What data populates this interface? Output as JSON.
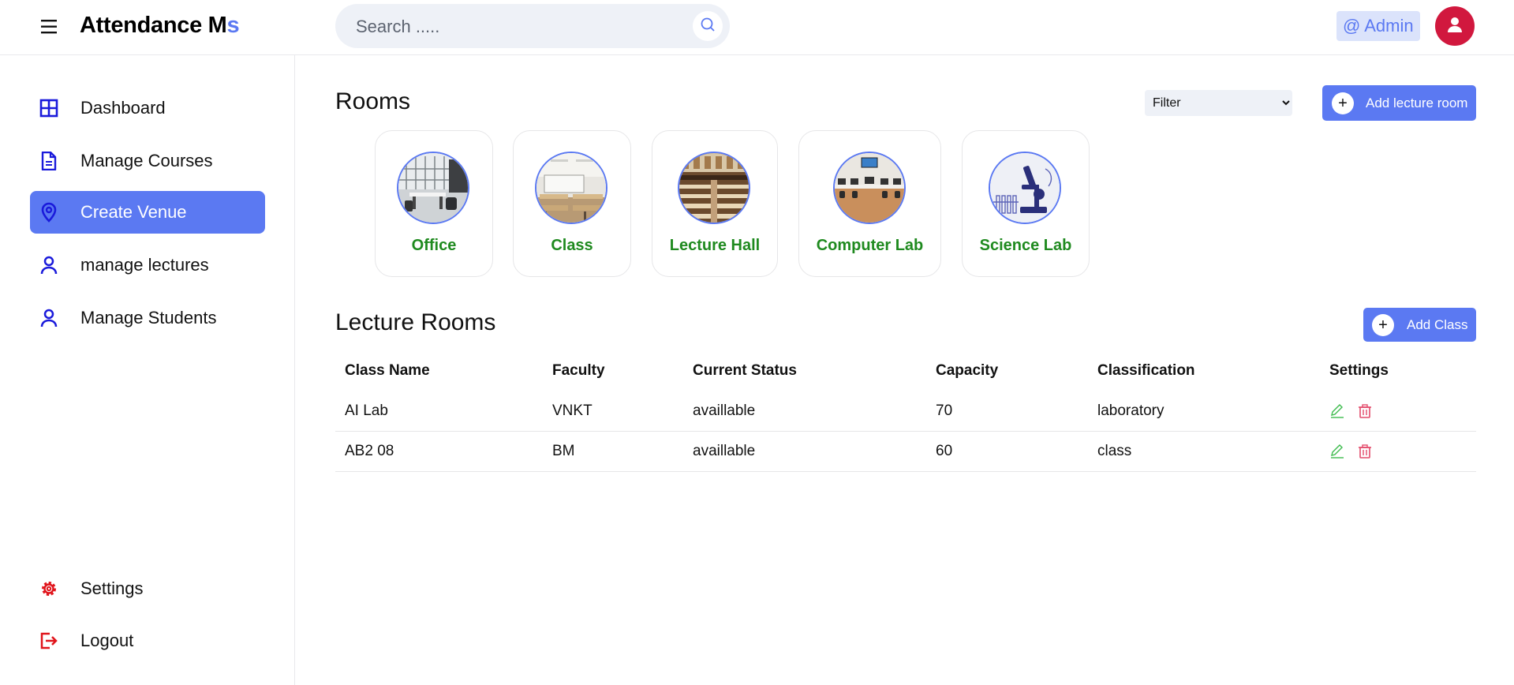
{
  "header": {
    "brand_main": "Attendance M",
    "brand_accent": "s",
    "search_placeholder": "Search .....",
    "user_badge": "@ Admin"
  },
  "sidebar": {
    "items": [
      {
        "label": "Dashboard",
        "icon": "grid-icon"
      },
      {
        "label": "Manage Courses",
        "icon": "document-icon"
      },
      {
        "label": "Create Venue",
        "icon": "location-pin-icon",
        "active": true
      },
      {
        "label": "manage lectures",
        "icon": "user-icon"
      },
      {
        "label": "Manage Students",
        "icon": "user-icon"
      }
    ],
    "bottom": [
      {
        "label": "Settings",
        "icon": "gear-icon"
      },
      {
        "label": "Logout",
        "icon": "logout-icon"
      }
    ]
  },
  "rooms": {
    "title": "Rooms",
    "filter": {
      "selected": "Filter",
      "options": [
        "Filter"
      ]
    },
    "add_label": "Add lecture room",
    "cards": [
      {
        "name": "Office",
        "image": "office-photo"
      },
      {
        "name": "Class",
        "image": "classroom-photo"
      },
      {
        "name": "Lecture Hall",
        "image": "lecture-hall-photo"
      },
      {
        "name": "Computer Lab",
        "image": "computer-lab-photo"
      },
      {
        "name": "Science Lab",
        "image": "microscope-photo"
      }
    ]
  },
  "lecture_rooms": {
    "title": "Lecture Rooms",
    "add_label": "Add Class",
    "columns": [
      "Class Name",
      "Faculty",
      "Current Status",
      "Capacity",
      "Classification",
      "Settings"
    ],
    "rows": [
      {
        "class_name": "AI Lab",
        "faculty": "VNKT",
        "status": "availlable",
        "capacity": "70",
        "classification": "laboratory"
      },
      {
        "class_name": "AB2 08",
        "faculty": "BM",
        "status": "availlable",
        "capacity": "60",
        "classification": "class"
      }
    ]
  },
  "colors": {
    "accent": "#5b79f2",
    "room_label": "#1f8a1f",
    "avatar": "#d1183e",
    "nav_icon": "#1a1adb",
    "bottom_icon": "#e0141b",
    "edit_icon": "#3dbb4d",
    "delete_icon": "#e34b6b"
  }
}
